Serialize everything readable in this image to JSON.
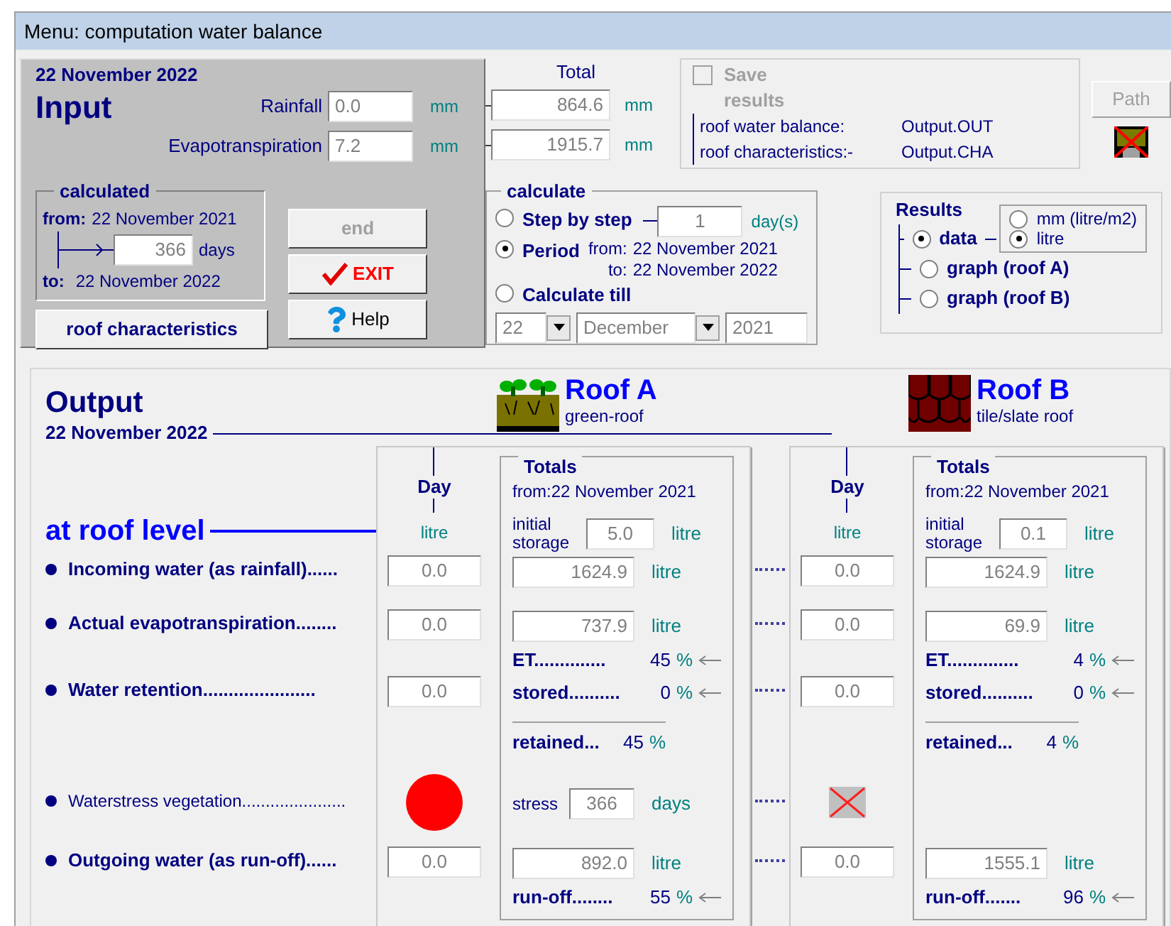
{
  "window": {
    "title": "Menu: computation water balance"
  },
  "input": {
    "date": "22 November 2022",
    "title": "Input",
    "total_heading": "Total",
    "fields": [
      {
        "label": "Rainfall",
        "value": "0.0",
        "unit": "mm",
        "total": "864.6",
        "total_unit": "mm"
      },
      {
        "label": "Evapotranspiration",
        "value": "7.2",
        "unit": "mm",
        "total": "1915.7",
        "total_unit": "mm"
      }
    ],
    "calculated": {
      "title": "calculated",
      "from_label": "from:",
      "from": "22 November 2021",
      "days": "366",
      "days_unit": "days",
      "to_label": "to:",
      "to": "22 November 2022"
    },
    "buttons": [
      {
        "kind": "end",
        "label": "end",
        "disabled": true
      },
      {
        "kind": "exit",
        "label": "EXIT",
        "disabled": false
      },
      {
        "kind": "help",
        "label": "Help",
        "disabled": false
      }
    ],
    "roof_button": "roof characteristics"
  },
  "save": {
    "label": "Save results",
    "checked": false,
    "disabled": true,
    "files": [
      {
        "label": "roof water balance:",
        "file": "Output.OUT"
      },
      {
        "label": "roof characteristics:-",
        "file": "Output.CHA"
      }
    ],
    "path_button": {
      "label": "Path",
      "disabled": true
    }
  },
  "calculate": {
    "title": "calculate",
    "options": [
      {
        "kind": "step",
        "label": "Step by step",
        "selected": false,
        "value": "1",
        "unit": "day(s)"
      },
      {
        "kind": "period",
        "label": "Period",
        "selected": true,
        "from_label": "from:",
        "from": "22 November 2021",
        "to_label": "to:",
        "to": "22 November 2022"
      },
      {
        "kind": "till",
        "label": "Calculate till",
        "selected": false
      }
    ],
    "till": {
      "day": "22",
      "month": "December",
      "year": "2021"
    }
  },
  "results": {
    "title": "Results",
    "options": [
      {
        "kind": "data",
        "label": "data",
        "selected": true,
        "units": [
          {
            "label": "mm (litre/m2)",
            "selected": false
          },
          {
            "label": "litre",
            "selected": true
          }
        ]
      },
      {
        "kind": "graph",
        "label": "graph (roof A)",
        "selected": false
      },
      {
        "kind": "graph",
        "label": "graph (roof B)",
        "selected": false
      }
    ]
  },
  "output": {
    "title": "Output",
    "date": "22 November 2022",
    "level_heading": "at roof level",
    "rows": [
      {
        "kind": "incoming",
        "label": "Incoming water (as rainfall)......"
      },
      {
        "kind": "actual",
        "label": "Actual evapotranspiration........"
      },
      {
        "kind": "retention",
        "label": "Water retention......................"
      },
      {
        "kind": "stress",
        "label": "Waterstress vegetation......................"
      },
      {
        "kind": "outgoing",
        "label": "Outgoing water (as run-off)......"
      }
    ],
    "roofs": [
      {
        "kind": "green",
        "name": "Roof A",
        "type": "green-roof",
        "day_heading": "Day",
        "day_unit": "litre",
        "day": {
          "incoming": "0.0",
          "actual": "0.0",
          "retention": "0.0",
          "stress": true,
          "outgoing": "0.0"
        },
        "totals": {
          "heading": "Totals",
          "from": "from:22 November 2021",
          "initial_label": "initial storage",
          "initial": "5.0",
          "initial_unit": "litre",
          "incoming": "1624.9",
          "incoming_unit": "litre",
          "actual": "737.9",
          "actual_unit": "litre",
          "et_label": "ET..............",
          "et": "45",
          "et_unit": "%",
          "stored_label": "stored..........",
          "stored": "0",
          "stored_unit": "%",
          "retained_label": "retained...",
          "retained": "45",
          "retained_unit": "%",
          "stress_label": "stress",
          "stress_days": "366",
          "stress_unit": "days",
          "runoff": "892.0",
          "runoff_unit": "litre",
          "runoff_label": "run-off........",
          "runoff_pct": "55",
          "runoff_pct_unit": "%"
        }
      },
      {
        "kind": "tile",
        "name": "Roof B",
        "type": "tile/slate roof",
        "day_heading": "Day",
        "day_unit": "litre",
        "day": {
          "incoming": "0.0",
          "actual": "0.0",
          "retention": "0.0",
          "stress": false,
          "outgoing": "0.0"
        },
        "totals": {
          "heading": "Totals",
          "from": "from:22 November 2021",
          "initial_label": "initial storage",
          "initial": "0.1",
          "initial_unit": "litre",
          "incoming": "1624.9",
          "incoming_unit": "litre",
          "actual": "69.9",
          "actual_unit": "litre",
          "et_label": "ET..............",
          "et": "4",
          "et_unit": "%",
          "stored_label": "stored..........",
          "stored": "0",
          "stored_unit": "%",
          "retained_label": "retained...",
          "retained": "4",
          "retained_unit": "%",
          "runoff": "1555.1",
          "runoff_unit": "litre",
          "runoff_label": "run-off.......",
          "runoff_pct": "96",
          "runoff_pct_unit": "%"
        }
      }
    ]
  }
}
